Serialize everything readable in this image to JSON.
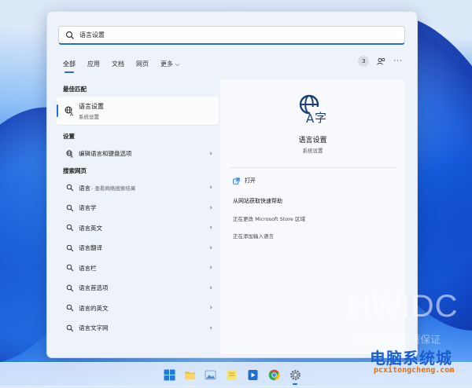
{
  "search": {
    "value": "语言设置"
  },
  "tabs": [
    {
      "label": "全部"
    },
    {
      "label": "应用"
    },
    {
      "label": "文档"
    },
    {
      "label": "网页"
    }
  ],
  "tab_more": "更多 ⌵",
  "toolbar": {
    "badge_count": "3",
    "more": "···"
  },
  "best_match": {
    "section": "最佳匹配",
    "title": "语言设置",
    "subtitle": "系统设置"
  },
  "settings": {
    "section": "设置",
    "items": [
      {
        "label": "编辑语言和键盘选项"
      }
    ]
  },
  "web": {
    "section": "搜索网页",
    "items": [
      {
        "label": "语言",
        "sub": " - 查看网络搜索结果"
      },
      {
        "label": "语言学",
        "sub": ""
      },
      {
        "label": "语言英文",
        "sub": ""
      },
      {
        "label": "语言翻译",
        "sub": ""
      },
      {
        "label": "语言栏",
        "sub": ""
      },
      {
        "label": "语言首选项",
        "sub": ""
      },
      {
        "label": "语言的英文",
        "sub": ""
      },
      {
        "label": "语言文字网",
        "sub": ""
      }
    ]
  },
  "detail": {
    "title": "语言设置",
    "subtitle": "系统设置",
    "open_label": "打开",
    "help_title": "从网站获取快速帮助",
    "help_items": [
      "正在更改 Microsoft Store 区域",
      "正在添加输入语言"
    ]
  },
  "taskbar": {
    "icons": [
      "windows-start-icon",
      "file-explorer-icon",
      "photos-icon",
      "notes-icon",
      "media-player-icon",
      "chrome-icon",
      "settings-icon"
    ]
  },
  "watermark": {
    "brand": "HWIDC",
    "tagline": "至真至诚 品质保证",
    "logo": "电脑系统城",
    "url": "pcxitongcheng.com"
  },
  "colors": {
    "accent": "#1e6fd0"
  }
}
